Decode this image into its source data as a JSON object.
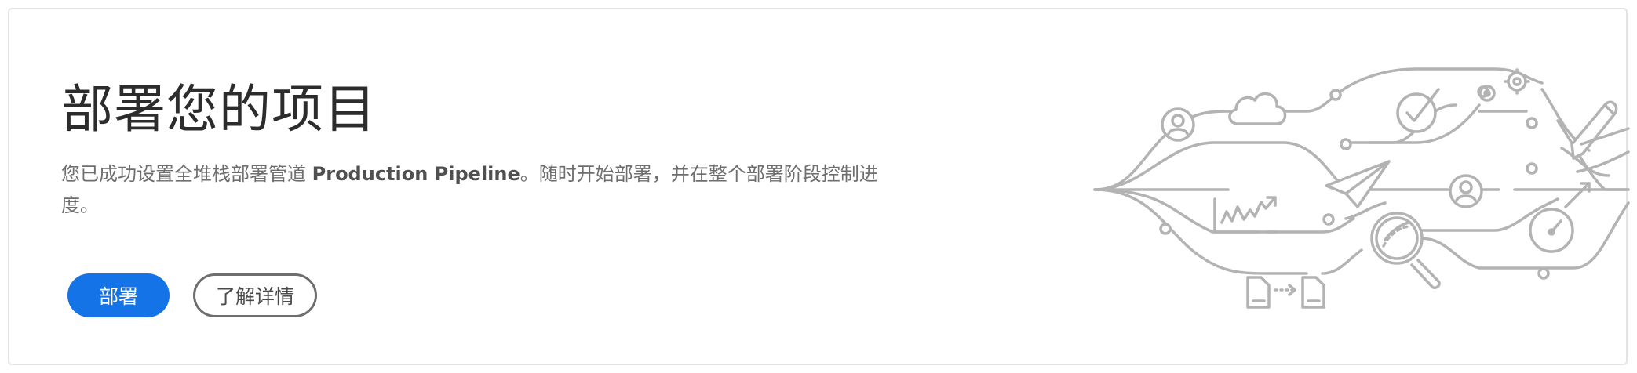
{
  "hero": {
    "title": "部署您的项目",
    "description_before": "您已成功设置全堆栈部署管道 ",
    "pipeline_name": "Production Pipeline",
    "description_after": "。随时开始部署，并在整个部署阶段控制进度。"
  },
  "actions": {
    "deploy_label": "部署",
    "learn_more_label": "了解详情"
  },
  "colors": {
    "primary_button": "#1473e6",
    "illustration_stroke": "#b3b3b3"
  },
  "illustration": {
    "icons": [
      "user-icon",
      "cloud-icon",
      "checkmark-icon",
      "gears-icon",
      "pen-icon",
      "paper-plane-icon",
      "chart-icon",
      "user-icon",
      "magnifier-icon",
      "speedometer-icon",
      "document-icon"
    ]
  }
}
